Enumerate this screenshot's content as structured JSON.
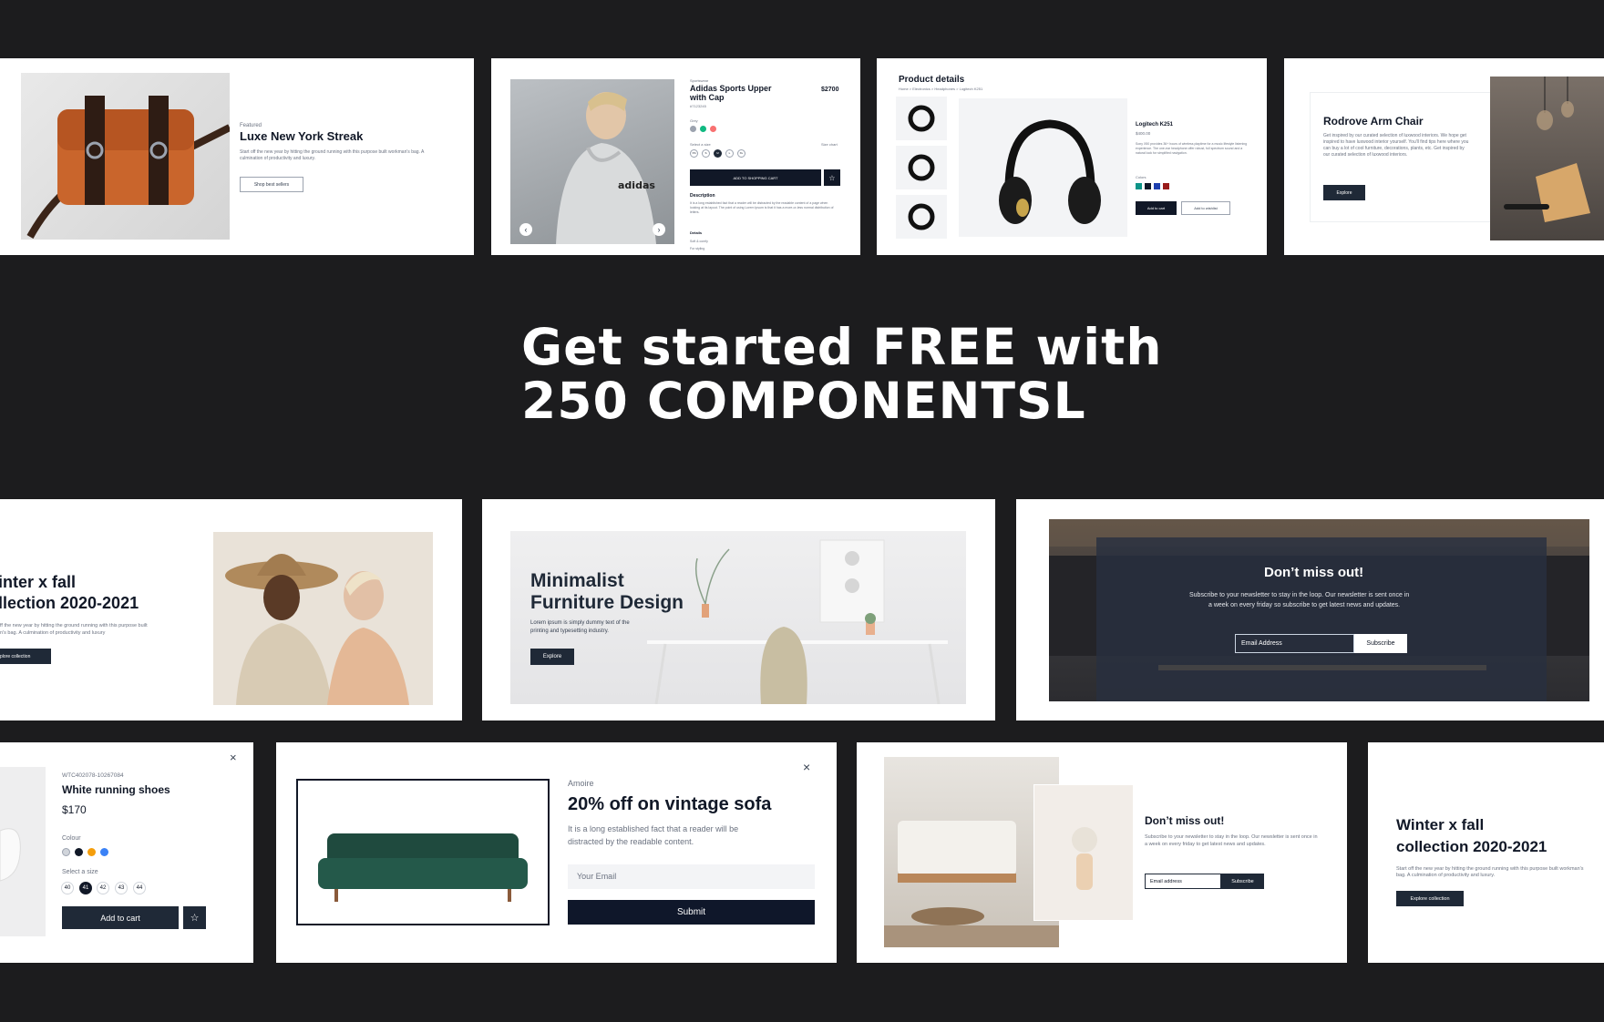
{
  "hero": {
    "line1": "Get started FREE with",
    "line2": "250 COMPONENTSL"
  },
  "bag_card": {
    "eyebrow": "Featured",
    "title": "Luxe New York Streak",
    "desc": "Start off the new year by hitting the ground running with this purpose built workman's bag. A culmination of productivity and luxury.",
    "button": "Shop best sellers"
  },
  "adidas_card": {
    "eyebrow": "Sportswear",
    "title_line1": "Adidas Sports Upper",
    "title_line2": "with Cap",
    "price": "$2700",
    "sku": "#7123245",
    "color_label": "Grey",
    "size_label": "Select a size",
    "size_chart": "Size chart",
    "sizes": [
      "XS",
      "S",
      "M",
      "L",
      "XL"
    ],
    "cta": "ADD TO SHOPPING CART",
    "desc_title": "Description",
    "desc": "It is a long established fact that a reader will be distracted by the readable content of a page when looking at its layout. The point of using Lorem Ipsum is that it has a more-or-less normal distribution of letters.",
    "details_title": "Details",
    "details": [
      "Soft & comfy",
      "For styling"
    ]
  },
  "headphone_card": {
    "title": "Product details",
    "breadcrumb": "Home > Electronics > Headphones > Logitech K251",
    "name": "Logitech K251",
    "price": "$400.00",
    "desc": "Sony X50 provides 36+ hours of wireless playtime for a music lifestyle listening experience. The one-ear headphone offer robust, full spectrum sound and a natural look for simplified navigation.",
    "colors_label": "Colors",
    "add_to_cart": "Add to cart",
    "add_to_wishlist": "Add to wishlist"
  },
  "chair_card": {
    "title": "Rodrove Arm Chair",
    "desc": "Get inspired by our curated selection of luxwood interiors. We hope get inspired to have luxwood interior yourself. You'll find tips here where you can buy a lot of cool furniture, decorations, plants, etc. Get inspired by our curated selection of luxwood interiors.",
    "button": "Explore"
  },
  "winter_left": {
    "title_line1": "inter x fall",
    "title_line2": "llection 2020-2021",
    "desc_line1": "ff the new year by hitting the ground running with this purpose built",
    "desc_line2": "n's bag. A culmination of productivity and luxury",
    "button": "plore collection"
  },
  "minimal_card": {
    "title_line1": "Minimalist",
    "title_line2": "Furniture Design",
    "desc_line1": "Lorem ipsum is simply dummy text of the",
    "desc_line2": "printing and typesetting industry.",
    "button": "Explore"
  },
  "newsletter_card": {
    "title": "Don’t miss out!",
    "desc_line1": "Subscribe to your newsletter to stay in the loop. Our newsletter is sent once in",
    "desc_line2": "a week on every friday so subscribe to get latest news and updates.",
    "placeholder": "Email Address",
    "button": "Subscribe"
  },
  "shoe_card": {
    "sku": "WTC402078-10267084",
    "name": "White running shoes",
    "price": "$170",
    "colour_label": "Colour",
    "size_label": "Select a size",
    "sizes": [
      "40",
      "41",
      "42",
      "43",
      "44"
    ],
    "cta": "Add to cart"
  },
  "sofa_card": {
    "brand": "Amoire",
    "title": "20% off on vintage sofa",
    "desc_line1": "It is a long established fact that a reader will be",
    "desc_line2": "distracted by the readable content.",
    "placeholder": "Your Email",
    "button": "Submit"
  },
  "mini_newsletter": {
    "title": "Don’t miss out!",
    "desc": "Subscribe to your newsletter to stay in the loop. Our newsletter is sent once in a week on every friday to get latest news and updates.",
    "placeholder": "Email address",
    "button": "Subscribe"
  },
  "winter_right": {
    "title_line1": "Winter x fall",
    "title_line2": "collection 2020-2021",
    "desc": "Start off the new year by hitting the ground running with this purpose built workman's bag. A culmination of productivity and luxury.",
    "button": "Explore collection"
  },
  "colors": {
    "background": "#1c1c1e",
    "dark_button": "#1f2937",
    "navy": "#0f172a"
  },
  "icons": [
    "chevron-left-icon",
    "chevron-right-icon",
    "star-icon",
    "close-icon"
  ]
}
